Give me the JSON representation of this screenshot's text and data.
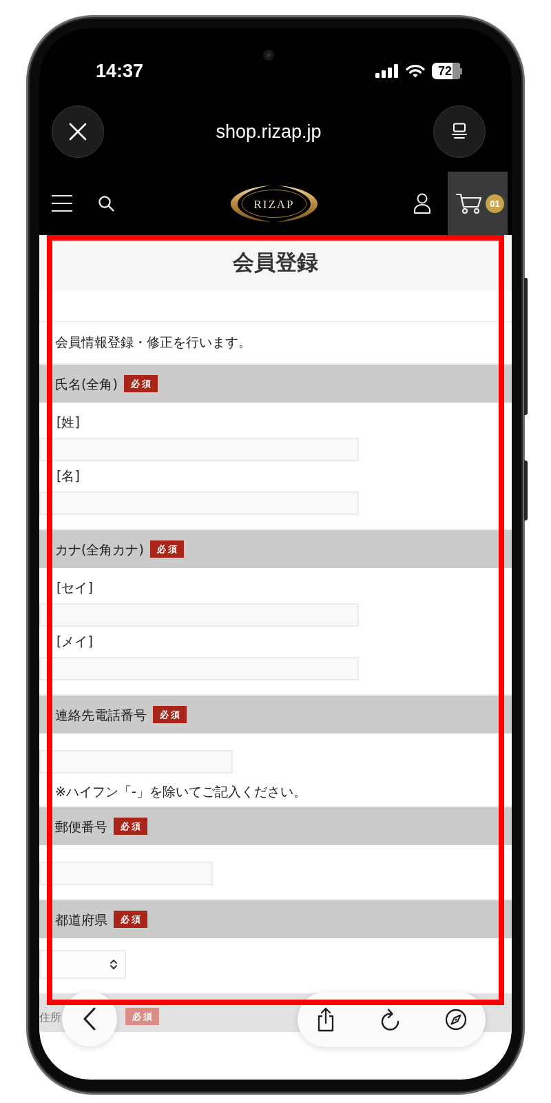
{
  "status_bar": {
    "time": "14:37",
    "battery": "72"
  },
  "browser_bar": {
    "url": "shop.rizap.jp"
  },
  "site_header": {
    "logo": "RIZAP",
    "cart_count": "01"
  },
  "page": {
    "title": "会員登録",
    "intro": "会員情報登録・修正を行います。"
  },
  "sections": [
    {
      "label": "氏名(全角)",
      "badge": "必須",
      "fields": [
        {
          "kind": "text",
          "label": "[姓]"
        },
        {
          "kind": "text",
          "label": "[名]"
        }
      ]
    },
    {
      "label": "カナ(全角カナ)",
      "badge": "必須",
      "fields": [
        {
          "kind": "text",
          "label": "[セイ]"
        },
        {
          "kind": "text",
          "label": "[メイ]"
        }
      ]
    },
    {
      "label": "連絡先電話番号",
      "badge": "必須",
      "fields": [
        {
          "kind": "tel"
        }
      ],
      "note": "※ハイフン「-」を除いてご記入ください。"
    },
    {
      "label": "郵便番号",
      "badge": "必須",
      "fields": [
        {
          "kind": "postal"
        }
      ]
    },
    {
      "label": "都道府県",
      "badge": "必須",
      "fields": [
        {
          "kind": "select"
        }
      ]
    },
    {
      "label": "住所",
      "badge": "必須"
    }
  ]
}
